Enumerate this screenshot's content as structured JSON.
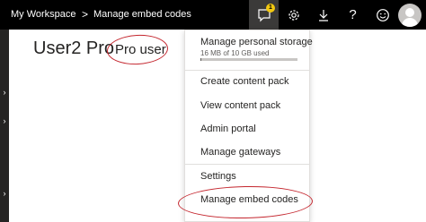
{
  "header": {
    "workspace": "My Workspace",
    "separator": ">",
    "page": "Manage embed codes",
    "notification_count": "1",
    "icons": [
      "notification-icon",
      "gear-icon",
      "download-icon",
      "help-icon",
      "smiley-icon",
      "avatar-icon"
    ]
  },
  "main": {
    "title": "User2 Pro",
    "annotation": "Pro user"
  },
  "menu": {
    "storage_title": "Manage personal storage",
    "storage_usage": "16 MB of 10 GB used",
    "storage_fraction": 0.0016,
    "items": [
      "Create content pack",
      "View content pack",
      "Admin portal",
      "Manage gateways",
      "Settings",
      "Manage embed codes"
    ]
  },
  "colors": {
    "topbar": "#000000",
    "badge": "#f2c811",
    "annotation": "#c4262e"
  }
}
